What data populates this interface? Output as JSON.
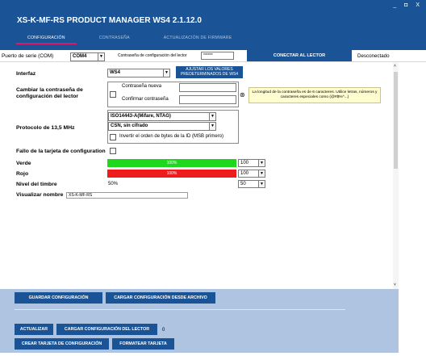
{
  "window": {
    "title": "XS-K-MF-RS  PRODUCT MANAGER WS4 2.1.12.0",
    "controls": "_ ◘ X"
  },
  "tabs": [
    {
      "label": "CONFIGURACIÓN",
      "active": true
    },
    {
      "label": "CONTRASEÑA",
      "active": false
    },
    {
      "label": "ACTUALIZACIÓN DE FIRMWARE",
      "active": false
    }
  ],
  "port": {
    "label": "Puerto de serie (COM)",
    "value": "COM4",
    "password_label": "Contraseña de configuración del lector",
    "password_value": "******",
    "connect_button": "CONECTAR AL LECTOR",
    "status": "Desconectado"
  },
  "form": {
    "interface": {
      "label": "Interfaz",
      "value": "WS4",
      "defaults_button": "AJUSTAR LOS VALORES PREDETERMINADOS DE WS4"
    },
    "password_change": {
      "label": "Cambiar la contraseña de configuración del lector",
      "new_label": "Contraseña nueva",
      "confirm_label": "Confirmar contraseña",
      "hint": "La longitud de la contraseña es de 6 caracteres. Utilice letras, números y caracteres especiales como (@#$%^...)",
      "eye_icon": "eye-icon"
    },
    "protocol": {
      "label": "Protocolo de 13,5 MHz",
      "standard": "ISO14443-A(Mifare, NTAG)",
      "mode": "CSN, sin cifrado",
      "invert_label": "Invertir el orden de bytes de la ID (MSB primero)"
    },
    "config_card_fail": {
      "label": "Fallo de la tarjeta de configuration"
    },
    "green": {
      "label": "Verde",
      "bar_text": "100%",
      "value": "100",
      "color": "#1ed81e"
    },
    "red": {
      "label": "Rojo",
      "bar_text": "100%",
      "value": "100",
      "color": "#ee1c1c"
    },
    "buzzer": {
      "label": "Nivel del timbre",
      "text": "50%",
      "value": "50"
    },
    "display_name": {
      "label": "Visualizar nombre",
      "value": "XS-K-MF-RS"
    }
  },
  "actions": {
    "save": "GUARDAR CONFIGURACIÓN",
    "load_file": "CARGAR CONFIGURACIÓN DESDE ARCHIVO",
    "refresh": "ACTUALIZAR",
    "load_reader": "CARGAR CONFIGURACIÓN DEL LECTOR",
    "counter": "0",
    "create_card": "CREAR TARJETA DE CONFIGURACIÓN",
    "format_card": "FORMATEAR TARJETA"
  },
  "colors": {
    "accent": "#1a5496",
    "tab_underline": "#e0166b",
    "panel": "#aec4e0"
  }
}
